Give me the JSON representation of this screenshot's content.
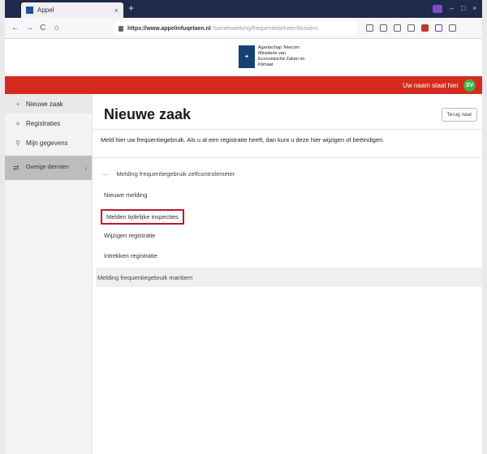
{
  "browser": {
    "tab_title": "Appel",
    "tab_close": "×",
    "new_tab": "+",
    "url_domain": "https://www.appelinfuqelaen.nl",
    "url_path": "/samenwerking/frequentiebeheer/dossiers",
    "nav": {
      "back": "←",
      "forward": "→",
      "reload": "C",
      "home": "⌂"
    },
    "window_min": "–",
    "window_max": "□",
    "window_close": "×"
  },
  "site": {
    "logo_mark": "✦",
    "logo_text": "Agentschap Telecom Ministerie van Economische Zaken en Klimaat",
    "user_link": "Uw naam staat hier",
    "avatar": "SV"
  },
  "sidebar": {
    "items": [
      {
        "icon": "+",
        "label": "Nieuwe zaak"
      },
      {
        "icon": "≡",
        "label": "Registraties"
      },
      {
        "icon": "⚲",
        "label": "Mijn gegevens"
      }
    ],
    "menu": {
      "icon": "⇄",
      "label": "Overige diensten",
      "chevron": "›"
    }
  },
  "main": {
    "title": "Nieuwe zaak",
    "back_button": "Terug naar",
    "intro": "Meld hier uw frequentiegebruik. Als u al een registratie heeft, dan kunt u deze hier wijzigen of beëindigen.",
    "section_dash": "—",
    "section_header": "Melding frequentiegebruik zelfcontrolemeter",
    "links": [
      "Nieuwe melding",
      "Melden tijdelijke inspecties",
      "Wijzigen registratie",
      "Intrekken registratie"
    ],
    "highlighted_index": 1,
    "bottom_section": "Melding frequentiegebruik maritiem"
  },
  "colors": {
    "header_red": "#d52b1e",
    "highlight_border": "#c0182a",
    "avatar_green": "#39b54a",
    "logo_blue": "#154273"
  }
}
